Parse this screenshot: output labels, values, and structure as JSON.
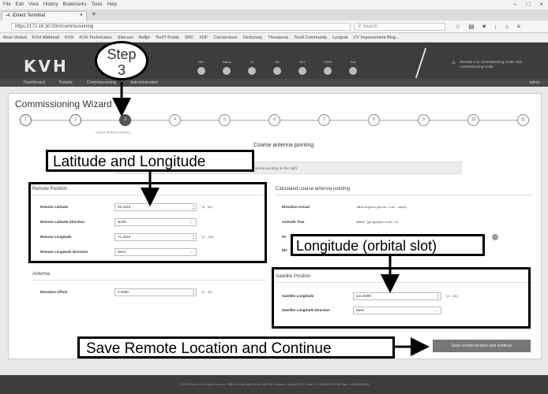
{
  "browser": {
    "menu": [
      "File",
      "Edit",
      "View",
      "History",
      "Bookmarks",
      "Tools",
      "Help"
    ],
    "window_controls": [
      "–",
      "□",
      "×"
    ],
    "tab_title": "-4. iDirect Terminal",
    "new_tab": "+",
    "url": "https://172.16.30.00/#/commissioning",
    "search_placeholder": "Search",
    "bookmarks": [
      "Most Visited",
      "KVH Webmail",
      "KVH",
      "KVH Technicians",
      "Sitecore",
      "Bellpr",
      "TeeIT Portal",
      "SRC",
      "XDF",
      "Conversions",
      "Dictionary",
      "Thesaurus",
      "Tivoli Community",
      "Lyngsat",
      "CV Improvement Blog..."
    ]
  },
  "app": {
    "logo": "KVH",
    "lights": [
      "NET",
      "Status",
      "Tx",
      "Sel",
      "Rx1",
      "TRAP",
      "Pwr"
    ],
    "alert": "Remote is in commissioning mode. Exit commissioning mode.",
    "nav": [
      "Dashboard",
      "Details",
      "Commissioning",
      "Administration"
    ],
    "admin": "admin"
  },
  "wizard": {
    "title": "Commissioning Wizard",
    "steps": [
      "1",
      "2",
      "3",
      "4",
      "5",
      "6",
      "7",
      "8",
      "9",
      "10",
      "11"
    ],
    "current_step_caption": "Coarse antenna pointing",
    "heading": "Coarse antenna pointing",
    "info": "Enter the remote position information below and press enter to calculate the coarse antenna pointing on the right."
  },
  "remote_position": {
    "title": "Remote Position",
    "rows": [
      {
        "label": "Remote Latitude",
        "value": "45.3215",
        "range": "° (0 - 90)",
        "kind": "spinner"
      },
      {
        "label": "Remote Latitude Direction",
        "value": "North",
        "range": "",
        "kind": "select"
      },
      {
        "label": "Remote Longitude",
        "value": "71.2016",
        "range": "° (0 - 180)",
        "kind": "spinner"
      },
      {
        "label": "Remote Longitude Direction",
        "value": "West",
        "range": "",
        "kind": "select"
      }
    ]
  },
  "coarse_pointing": {
    "title": "Calculated coarse antenna pointing",
    "rows": [
      {
        "label": "Elevation Actual",
        "value": "-36.0",
        "note": "degrees (actual = true - offset)"
      },
      {
        "label": "Azimuth True",
        "value": "193.5",
        "note": "° (geographic north = 0)"
      },
      {
        "label": "Polarization",
        "value": "",
        "note": ""
      },
      {
        "label": "Elevation",
        "value": "",
        "note": ""
      }
    ]
  },
  "antenna": {
    "title": "Antenna",
    "rows": [
      {
        "label": "Elevation Offset",
        "value": "0.0000",
        "range": "° (0 - 90)"
      }
    ]
  },
  "satellite_position": {
    "title": "Satellite Position",
    "rows": [
      {
        "label": "Satellite Longitude",
        "value": "121.0000",
        "range": "° (0 - 180)",
        "kind": "spinner"
      },
      {
        "label": "Satellite Longitude Direction",
        "value": "West",
        "range": "",
        "kind": "select"
      }
    ]
  },
  "save_button": "Save remote location and continue",
  "footer": "© 2016 iDirect, Inc. All rights reserved. 13861 Sunrise Valley Drive, Suite 300, Herndon, Virginia 20171 Phone: +1 703.648.8000 Toll Free: +1.866.345.0983",
  "annotations": {
    "step": "Step\n3",
    "lat_long": "Latitude and Longitude",
    "orbital": "Longitude (orbital slot)",
    "save": "Save Remote Location and Continue"
  },
  "colors": {
    "header_bg": "#3d3d3d",
    "accent_button": "#777777",
    "current_step": "#555555"
  }
}
